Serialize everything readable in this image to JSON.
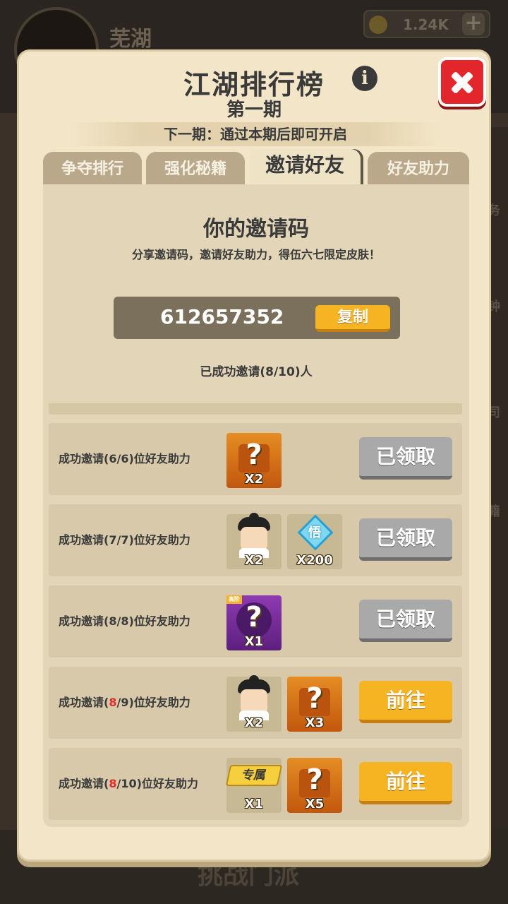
{
  "background": {
    "player_name": "芜湖",
    "currency_value": "1.24K",
    "side_labels": [
      "务",
      "钟",
      "司",
      "籍"
    ],
    "bottom_label": "挑战门派"
  },
  "modal": {
    "title": "江湖排行榜",
    "subtitle": "第一期",
    "next_period": "下一期：通过本期后即可开启",
    "tabs": [
      {
        "label": "争夺排行",
        "active": false
      },
      {
        "label": "强化秘籍",
        "active": false
      },
      {
        "label": "邀请好友",
        "active": true
      },
      {
        "label": "好友助力",
        "active": false
      }
    ]
  },
  "invite": {
    "title": "你的邀请码",
    "description": "分享邀请码，邀请好友助力，得伍六七限定皮肤！",
    "code": "612657352",
    "copy_label": "复制",
    "invited_count": "已成功邀请(8/10)人"
  },
  "rewards": [
    {
      "label_prefix": "成功邀请(",
      "label_current": "6",
      "label_rest": "/6)位好友助力",
      "current_red": false,
      "items": [
        {
          "icon": "mystery-outfit-icon",
          "qty": "X2"
        }
      ],
      "button": "已领取",
      "state": "claimed"
    },
    {
      "label_prefix": "成功邀请(",
      "label_current": "7",
      "label_rest": "/7)位好友助力",
      "current_red": false,
      "items": [
        {
          "icon": "hero-portrait-icon",
          "qty": "X2"
        },
        {
          "icon": "diamond-gem-icon",
          "gem_char": "悟",
          "qty": "X200"
        }
      ],
      "button": "已领取",
      "state": "claimed"
    },
    {
      "label_prefix": "成功邀请(",
      "label_current": "8",
      "label_rest": "/8)位好友助力",
      "current_red": false,
      "items": [
        {
          "icon": "advanced-mystery-icon",
          "tag": "高阶",
          "qty": "X1"
        }
      ],
      "button": "已领取",
      "state": "claimed"
    },
    {
      "label_prefix": "成功邀请(",
      "label_current": "8",
      "label_rest": "/9)位好友助力",
      "current_red": true,
      "items": [
        {
          "icon": "hero-portrait-icon",
          "qty": "X2"
        },
        {
          "icon": "mystery-outfit-icon",
          "qty": "X3"
        }
      ],
      "button": "前往",
      "state": "go"
    },
    {
      "label_prefix": "成功邀请(",
      "label_current": "8",
      "label_rest": "/10)位好友助力",
      "current_red": true,
      "items": [
        {
          "icon": "exclusive-badge-icon",
          "badge": "专属",
          "qty": "X1"
        },
        {
          "icon": "mystery-outfit-icon",
          "qty": "X5"
        }
      ],
      "button": "前往",
      "state": "go"
    }
  ],
  "colors": {
    "accent_orange": "#f6b322",
    "close_red": "#e32b2b",
    "claimed_gray": "#a9a9a9",
    "panel_bg": "#f3e6c8"
  }
}
